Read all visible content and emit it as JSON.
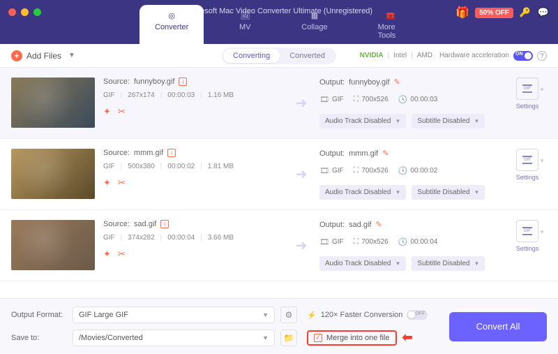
{
  "window": {
    "title": "Aiseesoft Mac Video Converter Ultimate (Unregistered)"
  },
  "promo": {
    "discount": "50% OFF"
  },
  "tabs": [
    {
      "label": "Converter",
      "active": true
    },
    {
      "label": "MV",
      "active": false
    },
    {
      "label": "Collage",
      "active": false
    },
    {
      "label": "More Tools",
      "active": false
    }
  ],
  "toolbar": {
    "add_files": "Add Files",
    "segments": {
      "converting": "Converting",
      "converted": "Converted"
    },
    "hw": {
      "nvidia": "NVIDIA",
      "intel": "Intel",
      "amd": "AMD",
      "label": "Hardware acceleration",
      "on": "ON"
    }
  },
  "items": [
    {
      "source_label": "Source:",
      "source_name": "funnyboy.gif",
      "format": "GIF",
      "dims": "267x174",
      "duration": "00:00:03",
      "size": "1.16 MB",
      "output_label": "Output:",
      "output_name": "funnyboy.gif",
      "out_format": "GIF",
      "out_dims": "700x526",
      "out_duration": "00:00:03",
      "audio": "Audio Track Disabled",
      "subtitle": "Subtitle Disabled",
      "settings": "Settings"
    },
    {
      "source_label": "Source:",
      "source_name": "mmm.gif",
      "format": "GIF",
      "dims": "500x380",
      "duration": "00:00:02",
      "size": "1.81 MB",
      "output_label": "Output:",
      "output_name": "mmm.gif",
      "out_format": "GIF",
      "out_dims": "700x526",
      "out_duration": "00:00:02",
      "audio": "Audio Track Disabled",
      "subtitle": "Subtitle Disabled",
      "settings": "Settings"
    },
    {
      "source_label": "Source:",
      "source_name": "sad.gif",
      "format": "GIF",
      "dims": "374x282",
      "duration": "00:00:04",
      "size": "3.66 MB",
      "output_label": "Output:",
      "output_name": "sad.gif",
      "out_format": "GIF",
      "out_dims": "700x526",
      "out_duration": "00:00:04",
      "audio": "Audio Track Disabled",
      "subtitle": "Subtitle Disabled",
      "settings": "Settings"
    }
  ],
  "footer": {
    "output_format_label": "Output Format:",
    "output_format_value": "GIF Large GIF",
    "save_to_label": "Save to:",
    "save_to_value": "/Movies/Converted",
    "faster": "120× Faster Conversion",
    "faster_off": "OFF",
    "merge": "Merge into one file",
    "convert": "Convert All"
  }
}
